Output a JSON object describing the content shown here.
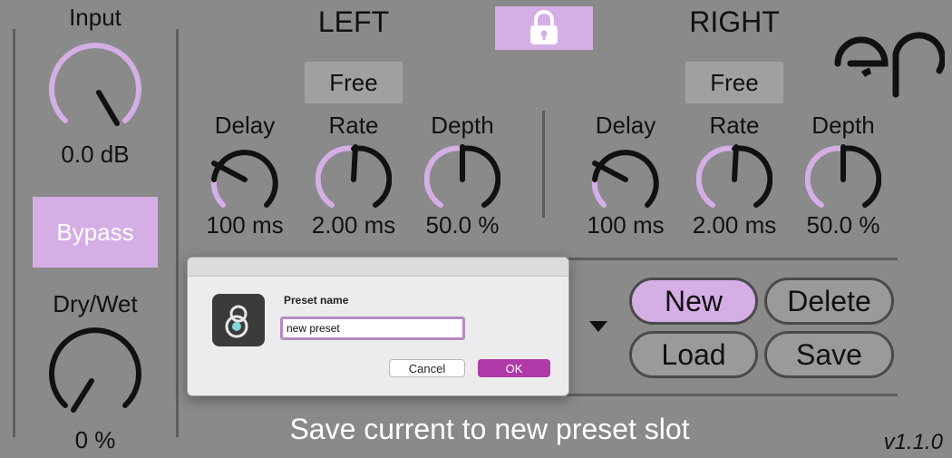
{
  "input": {
    "label": "Input",
    "value": "0.0 dB"
  },
  "bypass_label": "Bypass",
  "drywet": {
    "label": "Dry/Wet",
    "value": "0 %"
  },
  "left": {
    "title": "LEFT",
    "mode": "Free",
    "delay": {
      "label": "Delay",
      "value": "100 ms"
    },
    "rate": {
      "label": "Rate",
      "value": "2.00 ms"
    },
    "depth": {
      "label": "Depth",
      "value": "50.0 %"
    }
  },
  "right": {
    "title": "RIGHT",
    "mode": "Free",
    "delay": {
      "label": "Delay",
      "value": "100 ms"
    },
    "rate": {
      "label": "Rate",
      "value": "2.00 ms"
    },
    "depth": {
      "label": "Depth",
      "value": "50.0 %"
    }
  },
  "link_icon": "lock-icon",
  "preset_buttons": {
    "new": "New",
    "delete": "Delete",
    "load": "Load",
    "save": "Save"
  },
  "dialog": {
    "label": "Preset name",
    "input_value": "new preset",
    "cancel": "Cancel",
    "ok": "OK"
  },
  "status": "Save current to new preset slot",
  "version": "v1.1.0",
  "colors": {
    "accent": "#d5aee6",
    "background": "#8a8a8a",
    "ok_button": "#b03aa8"
  }
}
